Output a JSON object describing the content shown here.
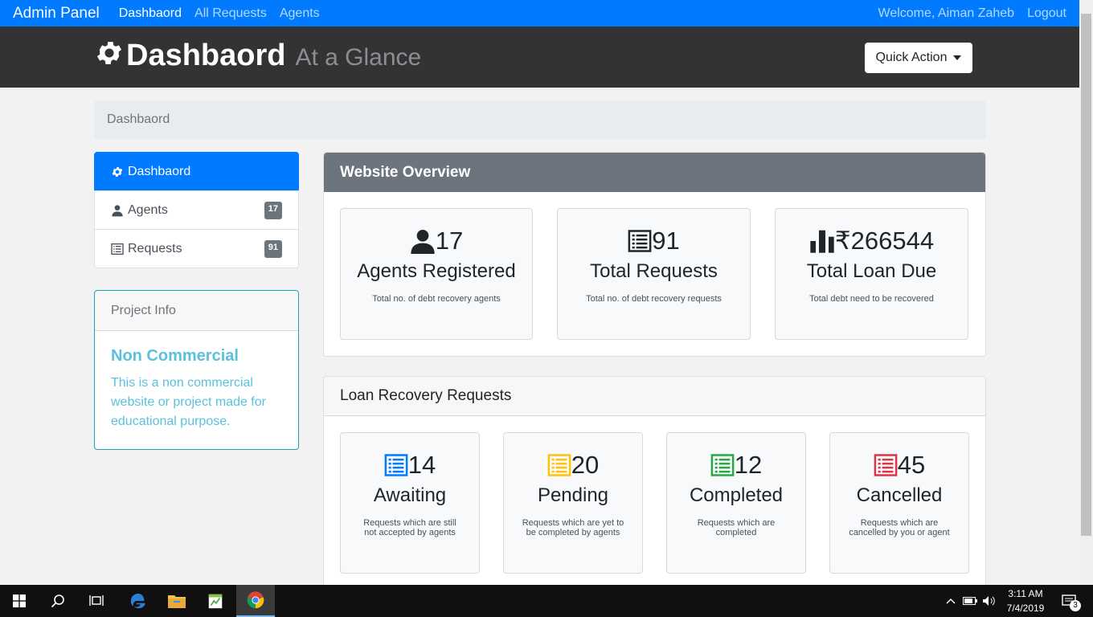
{
  "navbar": {
    "brand": "Admin Panel",
    "links": [
      "Dashbaord",
      "All Requests",
      "Agents"
    ],
    "welcome": "Welcome, Aiman Zaheb",
    "logout": "Logout"
  },
  "header": {
    "title": "Dashbaord",
    "subtitle": "At a Glance",
    "quick_action": "Quick Action"
  },
  "breadcrumb": "Dashbaord",
  "sidebar": {
    "items": [
      {
        "label": "Dashbaord"
      },
      {
        "label": "Agents",
        "badge": "17"
      },
      {
        "label": "Requests",
        "badge": "91"
      }
    ]
  },
  "project_info": {
    "header": "Project Info",
    "title": "Non Commercial",
    "text": "This is a non commercial website or project made for educational purpose."
  },
  "overview": {
    "title": "Website Overview",
    "stats": [
      {
        "value": "17",
        "label": "Agents Registered",
        "desc": "Total no. of debt recovery agents",
        "icon": "user-icon"
      },
      {
        "value": "91",
        "label": "Total Requests",
        "desc": "Total no. of debt recovery requests",
        "icon": "list-icon"
      },
      {
        "value": "₹266544",
        "label": "Total Loan Due",
        "desc": "Total debt need to be recovered",
        "icon": "bar-chart-icon"
      }
    ]
  },
  "loan": {
    "title": "Loan Recovery Requests",
    "stats": [
      {
        "value": "14",
        "label": "Awaiting",
        "desc": "Requests which are still not accepted by agents",
        "color": "#007bff"
      },
      {
        "value": "20",
        "label": "Pending",
        "desc": "Requests which are yet to be completed by agents",
        "color": "#ffc107"
      },
      {
        "value": "12",
        "label": "Completed",
        "desc": "Requests which are completed",
        "color": "#28a745"
      },
      {
        "value": "45",
        "label": "Cancelled",
        "desc": "Requests which are cancelled by you or agent",
        "color": "#dc3545"
      }
    ]
  },
  "taskbar": {
    "time": "3:11 AM",
    "date": "7/4/2019",
    "notifications": "3"
  }
}
